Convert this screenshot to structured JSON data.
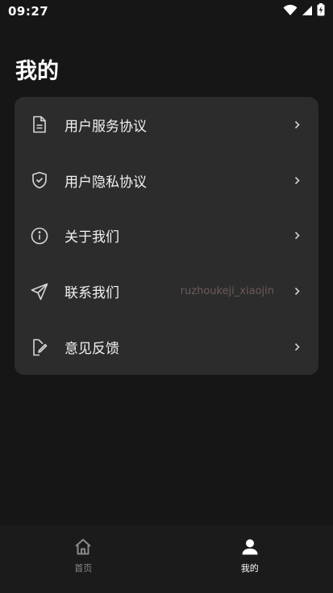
{
  "status_bar": {
    "time": "09:27",
    "icons": [
      "wifi-icon",
      "signal-icon",
      "battery-charging-icon"
    ]
  },
  "page": {
    "title": "我的"
  },
  "menu": {
    "items": [
      {
        "label": "用户服务协议",
        "icon": "document-icon",
        "value": ""
      },
      {
        "label": "用户隐私协议",
        "icon": "shield-check-icon",
        "value": ""
      },
      {
        "label": "关于我们",
        "icon": "info-circle-icon",
        "value": ""
      },
      {
        "label": "联系我们",
        "icon": "send-icon",
        "value": "ruzhoukeji_xiaojin"
      },
      {
        "label": "意见反馈",
        "icon": "feedback-edit-icon",
        "value": ""
      }
    ]
  },
  "bottom_nav": {
    "items": [
      {
        "label": "首页",
        "icon": "home-icon",
        "active": false
      },
      {
        "label": "我的",
        "icon": "user-icon",
        "active": true
      }
    ]
  },
  "colors": {
    "background": "#161616",
    "card": "#2c2c2c",
    "nav_background": "#1b1b1b",
    "active": "#ffffff",
    "inactive": "#8a8a8a"
  }
}
